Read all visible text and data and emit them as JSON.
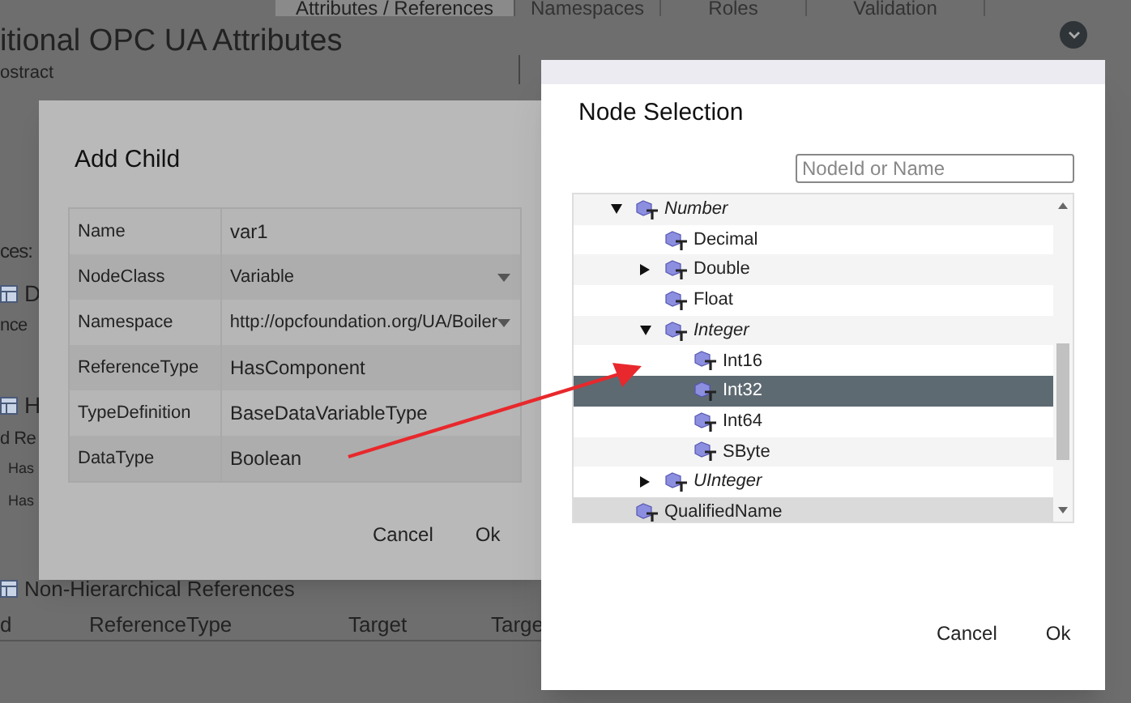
{
  "background": {
    "tabs": [
      {
        "label": "Attributes / References",
        "selected": true
      },
      {
        "label": "Namespaces",
        "selected": false
      },
      {
        "label": "Roles",
        "selected": false
      },
      {
        "label": "Validation",
        "selected": false
      }
    ],
    "heading": "itional OPC UA Attributes",
    "field_text": "ostract",
    "section": "ces:",
    "items": [
      {
        "kind": "table",
        "text": "D"
      },
      {
        "kind": "text",
        "text": "nce"
      },
      {
        "kind": "table",
        "text": "H"
      },
      {
        "kind": "text",
        "text": "d Re"
      },
      {
        "kind": "row",
        "text": "Has"
      },
      {
        "kind": "row",
        "text": "Has"
      }
    ],
    "non_hierarchical": "Non-Hierarchical References",
    "columns": [
      "d",
      "ReferenceType",
      "Target",
      "Targe"
    ]
  },
  "add_child": {
    "title": "Add Child",
    "fields": [
      {
        "label": "Name",
        "value": "var1",
        "kind": "text"
      },
      {
        "label": "NodeClass",
        "value": "Variable",
        "kind": "dropdown"
      },
      {
        "label": "Namespace",
        "value": "http://opcfoundation.org/UA/Boiler",
        "kind": "dropdown"
      },
      {
        "label": "ReferenceType",
        "value": "HasComponent",
        "kind": "text"
      },
      {
        "label": "TypeDefinition",
        "value": "BaseDataVariableType",
        "kind": "text"
      },
      {
        "label": "DataType",
        "value": "Boolean",
        "kind": "text"
      }
    ],
    "buttons": [
      "Cancel",
      "Ok"
    ]
  },
  "node_selection": {
    "title": "Node Selection",
    "search": {
      "placeholder": "NodeId or Name"
    },
    "tree": [
      {
        "label": "Number",
        "italic": true,
        "expanded": true,
        "selected": false,
        "highlighted": false,
        "children": [
          {
            "label": "Decimal",
            "italic": false,
            "selected": false,
            "highlighted": false
          },
          {
            "label": "Double",
            "italic": false,
            "expanded": false,
            "selected": false,
            "highlighted": false
          },
          {
            "label": "Float",
            "italic": false,
            "selected": false,
            "highlighted": false
          },
          {
            "label": "Integer",
            "italic": true,
            "expanded": true,
            "selected": false,
            "highlighted": false,
            "children": [
              {
                "label": "Int16",
                "italic": false,
                "selected": false,
                "highlighted": false
              },
              {
                "label": "Int32",
                "italic": false,
                "selected": true,
                "highlighted": false
              },
              {
                "label": "Int64",
                "italic": false,
                "selected": false,
                "highlighted": false
              },
              {
                "label": "SByte",
                "italic": false,
                "selected": false,
                "highlighted": false
              }
            ]
          },
          {
            "label": "UInteger",
            "italic": true,
            "expanded": false,
            "selected": false,
            "highlighted": false
          }
        ]
      },
      {
        "label": "QualifiedName",
        "italic": false,
        "selected": false,
        "highlighted": true
      }
    ],
    "buttons": [
      "Cancel",
      "Ok"
    ]
  }
}
